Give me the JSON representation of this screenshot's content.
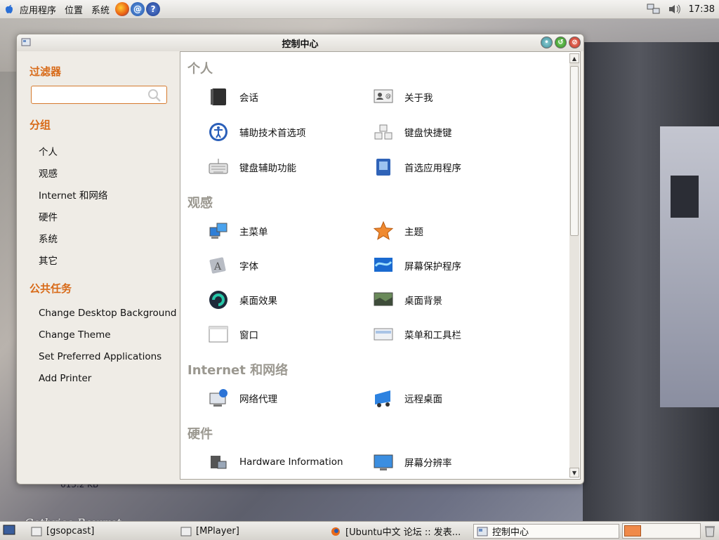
{
  "top_panel": {
    "menus": [
      "应用程序",
      "位置",
      "系统"
    ],
    "clock": "17:38"
  },
  "window": {
    "title": "控制中心"
  },
  "sidebar": {
    "filter_heading": "过滤器",
    "search_value": "",
    "groups_heading": "分组",
    "groups": [
      "个人",
      "观感",
      "Internet 和网络",
      "硬件",
      "系统",
      "其它"
    ],
    "tasks_heading": "公共任务",
    "tasks": [
      "Change Desktop Background",
      "Change Theme",
      "Set Preferred Applications",
      "Add Printer"
    ]
  },
  "content": {
    "categories": [
      {
        "title": "个人",
        "items": [
          "会话",
          "关于我",
          "辅助技术首选项",
          "键盘快捷键",
          "键盘辅助功能",
          "首选应用程序"
        ]
      },
      {
        "title": "观感",
        "items": [
          "主菜单",
          "主题",
          "字体",
          "屏幕保护程序",
          "桌面效果",
          "桌面背景",
          "窗口",
          "菜单和工具栏"
        ]
      },
      {
        "title": "Internet 和网络",
        "items": [
          "网络代理",
          "远程桌面"
        ]
      },
      {
        "title": "硬件",
        "items": [
          "Hardware Information",
          "屏幕分辨率"
        ]
      }
    ]
  },
  "taskbar": {
    "tasks": [
      "[gsopcast]",
      "[MPlayer]",
      "[Ubuntu中文 论坛 :: 发表...",
      "控制中心"
    ]
  },
  "desktop": {
    "file_size_text": "613.2 KB",
    "signature": "Cethrice Bourret"
  },
  "colors": {
    "accent_orange": "#d86a18",
    "category_gray": "#9b9890"
  }
}
